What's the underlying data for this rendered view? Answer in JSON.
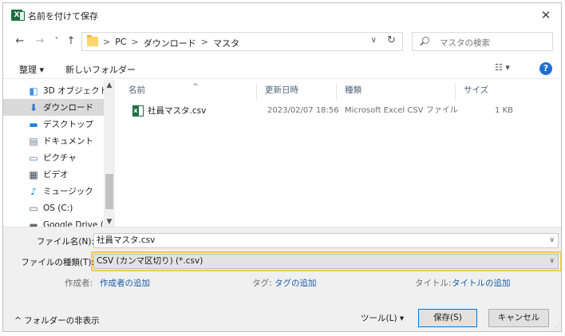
{
  "window": {
    "title": "名前を付けて保存",
    "app_icon": "excel-icon",
    "close_glyph": "✕"
  },
  "nav": {
    "back": "←",
    "forward": "→",
    "recent": "˅",
    "up": "↑",
    "breadcrumbs": [
      "PC",
      "ダウンロード",
      "マスタ"
    ],
    "separator": ">",
    "dropdown": "∨",
    "refresh": "↻",
    "search_placeholder": "マスタの検索"
  },
  "toolbar": {
    "organize": "整理 ▾",
    "new_folder": "新しいフォルダー",
    "view": "☷ ▾",
    "help": "?"
  },
  "navpane": {
    "items": [
      {
        "label": "3D オブジェクト",
        "icon": "3d-objects-icon",
        "glyph": "◧",
        "color": "#3a8ee6",
        "selected": false
      },
      {
        "label": "ダウンロード",
        "icon": "download-icon",
        "glyph": "⬇",
        "color": "#2a72c9",
        "selected": true
      },
      {
        "label": "デスクトップ",
        "icon": "desktop-icon",
        "glyph": "▬",
        "color": "#1e7fd8",
        "selected": false
      },
      {
        "label": "ドキュメント",
        "icon": "document-icon",
        "glyph": "▤",
        "color": "#6d7f96",
        "selected": false
      },
      {
        "label": "ピクチャ",
        "icon": "pictures-icon",
        "glyph": "▭",
        "color": "#4d7db8",
        "selected": false
      },
      {
        "label": "ビデオ",
        "icon": "video-icon",
        "glyph": "▦",
        "color": "#3c4a5c",
        "selected": false
      },
      {
        "label": "ミュージック",
        "icon": "music-icon",
        "glyph": "♪",
        "color": "#1e7fd8",
        "selected": false
      },
      {
        "label": "OS (C:)",
        "icon": "drive-icon",
        "glyph": "▭",
        "color": "#5e6b7a",
        "selected": false
      },
      {
        "label": "Google Drive (G:",
        "icon": "google-drive-icon",
        "glyph": "▬",
        "color": "#6b6b6b",
        "selected": false
      }
    ],
    "scroll_up": "▲",
    "scroll_down": "▼"
  },
  "filelist": {
    "columns": [
      "名前",
      "更新日時",
      "種類",
      "サイズ"
    ],
    "sort_indicator": "^",
    "files": [
      {
        "name": "社員マスタ.csv",
        "modified": "2023/02/07 18:56",
        "type": "Microsoft Excel CSV ファイル",
        "size": "1 KB"
      }
    ]
  },
  "form": {
    "filename_label": "ファイル名(N):",
    "filename_value": "社員マスタ.csv",
    "filetype_label": "ファイルの種類(T):",
    "filetype_value": "CSV (カンマ区切り) (*.csv)",
    "dropdown": "∨",
    "author_label": "作成者:",
    "author_link": "作成者の追加",
    "tags_label": "タグ:",
    "tags_link": "タグの追加",
    "title_label": "タイトル:",
    "title_link": "タイトルの追加"
  },
  "footer": {
    "hide_folders": "^ フォルダーの非表示",
    "tools": "ツール(L)  ▾",
    "save": "保存(S)",
    "cancel": "キャンセル",
    "grip": "⋰"
  },
  "colors": {
    "highlight": "#f2c94c",
    "link": "#1a5ca8",
    "selected": "#d9d9d9"
  }
}
